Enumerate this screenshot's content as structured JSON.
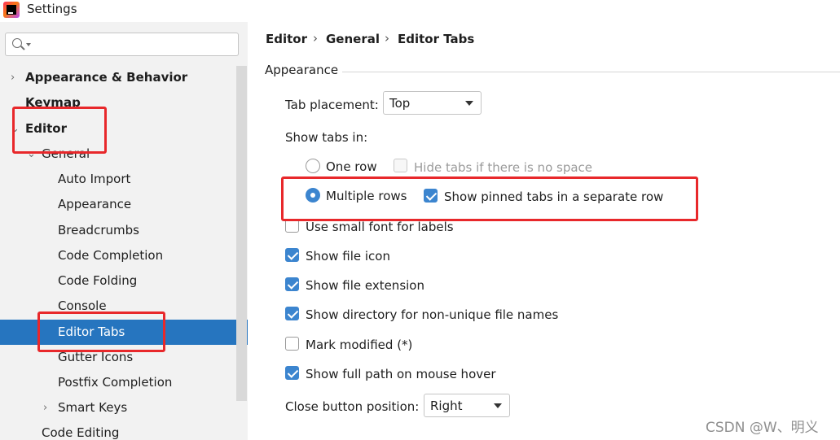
{
  "window": {
    "title": "Settings"
  },
  "sidebar": {
    "search": {
      "placeholder": ""
    },
    "items": [
      {
        "label": "Appearance & Behavior",
        "chevron": "›"
      },
      {
        "label": "Keymap"
      },
      {
        "label": "Editor",
        "chevron": "⌄"
      },
      {
        "label": "General",
        "chevron": "⌄"
      },
      {
        "label": "Auto Import"
      },
      {
        "label": "Appearance"
      },
      {
        "label": "Breadcrumbs"
      },
      {
        "label": "Code Completion"
      },
      {
        "label": "Code Folding"
      },
      {
        "label": "Console"
      },
      {
        "label": "Editor Tabs"
      },
      {
        "label": "Gutter Icons"
      },
      {
        "label": "Postfix Completion"
      },
      {
        "label": "Smart Keys",
        "chevron": "›"
      },
      {
        "label": "Code Editing"
      }
    ]
  },
  "breadcrumb": {
    "items": [
      "Editor",
      "General",
      "Editor Tabs"
    ],
    "separator": "›"
  },
  "appearance": {
    "group_title": "Appearance",
    "tab_placement": {
      "label": "Tab placement:",
      "value": "Top"
    },
    "show_tabs_in": {
      "label": "Show tabs in:"
    },
    "one_row": {
      "label": "One row",
      "checked": false
    },
    "hide_tabs": {
      "label": "Hide tabs if there is no space",
      "checked": false,
      "enabled": false
    },
    "multiple_rows": {
      "label": "Multiple rows",
      "checked": true
    },
    "pinned_separate": {
      "label": "Show pinned tabs in a separate row",
      "checked": true
    },
    "small_font": {
      "label": "Use small font for labels",
      "checked": false
    },
    "file_icon": {
      "label": "Show file icon",
      "checked": true
    },
    "file_extension": {
      "label": "Show file extension",
      "checked": true
    },
    "directory": {
      "label": "Show directory for non-unique file names",
      "checked": true
    },
    "mark_modified": {
      "label": "Mark modified (*)",
      "checked": false
    },
    "full_path": {
      "label": "Show full path on mouse hover",
      "checked": true
    },
    "close_button": {
      "label": "Close button position:",
      "value": "Right"
    }
  },
  "watermark": "CSDN @W、明义",
  "colors": {
    "selection": "#2675bf",
    "accent": "#3c85cf",
    "annotation": "#e8282b"
  }
}
